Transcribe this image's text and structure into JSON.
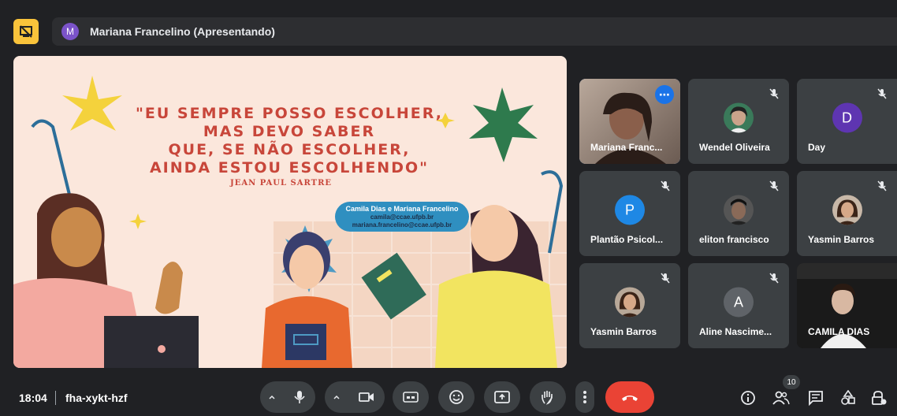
{
  "presenter": {
    "initial": "M",
    "label": "Mariana Francelino (Apresentando)"
  },
  "slide": {
    "quote": "\"EU SEMPRE POSSO ESCOLHER,\nMAS DEVO SABER\nQUE, SE NÃO ESCOLHER,\nAINDA ESTOU ESCOLHENDO\"",
    "author": "JEAN PAUL SARTRE",
    "contact_names": "Camila Dias e Mariana Francelino",
    "contact_email1": "camila@ccae.ufpb.br",
    "contact_email2": "mariana.francelino@ccae.ufpb.br"
  },
  "participants": [
    {
      "name": "Mariana Franc...",
      "kind": "video"
    },
    {
      "name": "Wendel Oliveira",
      "kind": "photo"
    },
    {
      "name": "Day",
      "kind": "avatar",
      "initial": "D",
      "color": "#5e35b1"
    },
    {
      "name": "Plantão Psicol...",
      "kind": "avatar",
      "initial": "P",
      "color": "#1e88e5"
    },
    {
      "name": "eliton francisco",
      "kind": "photo"
    },
    {
      "name": "Yasmin Barros",
      "kind": "photo"
    },
    {
      "name": "Yasmin Barros",
      "kind": "photo"
    },
    {
      "name": "Aline Nascime...",
      "kind": "avatar",
      "initial": "A",
      "color": "#5f6368"
    },
    {
      "name": "CAMILA DIAS",
      "kind": "video"
    }
  ],
  "bottom": {
    "time": "18:04",
    "meeting_code": "fha-xykt-hzf",
    "people_count": "10"
  },
  "colors": {
    "accent": "#8ab4f8",
    "hangup": "#ea4335",
    "tile": "#3c4043"
  }
}
